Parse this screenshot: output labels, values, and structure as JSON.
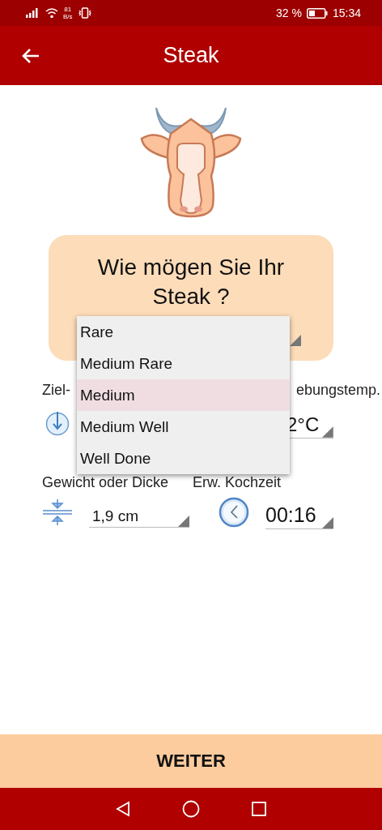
{
  "status_bar": {
    "network_speed": "81",
    "network_unit": "B/s",
    "battery": "32 %",
    "time": "15:34"
  },
  "app_bar": {
    "title": "Steak"
  },
  "question": {
    "text": "Wie mögen Sie Ihr Steak ?"
  },
  "doneness_options": [
    {
      "label": "Rare",
      "selected": false
    },
    {
      "label": "Medium Rare",
      "selected": false
    },
    {
      "label": "Medium",
      "selected": true
    },
    {
      "label": "Medium Well",
      "selected": false
    },
    {
      "label": "Well Done",
      "selected": false
    }
  ],
  "target_temp": {
    "label": "Ziel-"
  },
  "ambient_temp": {
    "label": "ebungstemp.",
    "value": "2°C"
  },
  "thickness": {
    "label": "Gewicht oder Dicke",
    "value": "1,9 cm"
  },
  "cook_time": {
    "label": "Erw. Kochzeit",
    "value": "00:16"
  },
  "next_button": {
    "label": "WEITER"
  }
}
